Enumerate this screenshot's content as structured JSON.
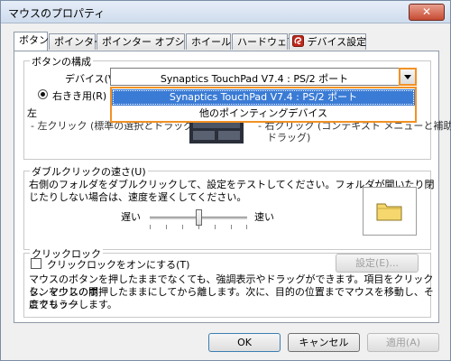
{
  "window": {
    "title": "マウスのプロパティ",
    "close_label": "✕"
  },
  "tabs": [
    {
      "label": "ボタン",
      "active": true
    },
    {
      "label": "ポインター"
    },
    {
      "label": "ポインター オプション"
    },
    {
      "label": "ホイール"
    },
    {
      "label": "ハードウェア"
    },
    {
      "label": "デバイス設定"
    }
  ],
  "button_config": {
    "group_label": "ボタンの構成",
    "device_label": "デバイス(V):",
    "device_value": "Synaptics TouchPad V7.4 : PS/2 ポート",
    "dropdown_options": [
      "Synaptics TouchPad V7.4 : PS/2 ポート",
      "他のポインティングデバイス"
    ],
    "right_handed_label": "右きき用(R)",
    "left_label": "左",
    "left_click_desc": "- 左クリック (標準の選択とドラッグ)",
    "right_click_desc": "- 右クリック (コンテキスト メニューと補助",
    "right_drag": "ドラッグ)"
  },
  "double_click": {
    "group_label": "ダブルクリックの速さ(U)",
    "description_1": "右側のフォルダをダブルクリックして、設定をテストしてください。フォルダが開いたり閉",
    "description_2": "じたりしない場合は、速度を遅くしてください。",
    "slow_label": "遅い",
    "fast_label": "速い",
    "speed": 0.5
  },
  "click_lock": {
    "group_label": "クリックロック",
    "checkbox_label": "クリックロックをオンにする(T)",
    "settings_button": "設定(E)...",
    "description_1": "マウスのボタンを押したままでなくても、強調表示やドラッグができます。項目をクリックし、マウスのボ",
    "description_2": "タンを少しの間押したままにしてから離します。次に、目的の位置までマウスを移動し、そこでもう一",
    "description_3": "度クリックします。"
  },
  "footer": {
    "ok": "OK",
    "cancel": "キャンセル",
    "apply": "適用(A)"
  }
}
